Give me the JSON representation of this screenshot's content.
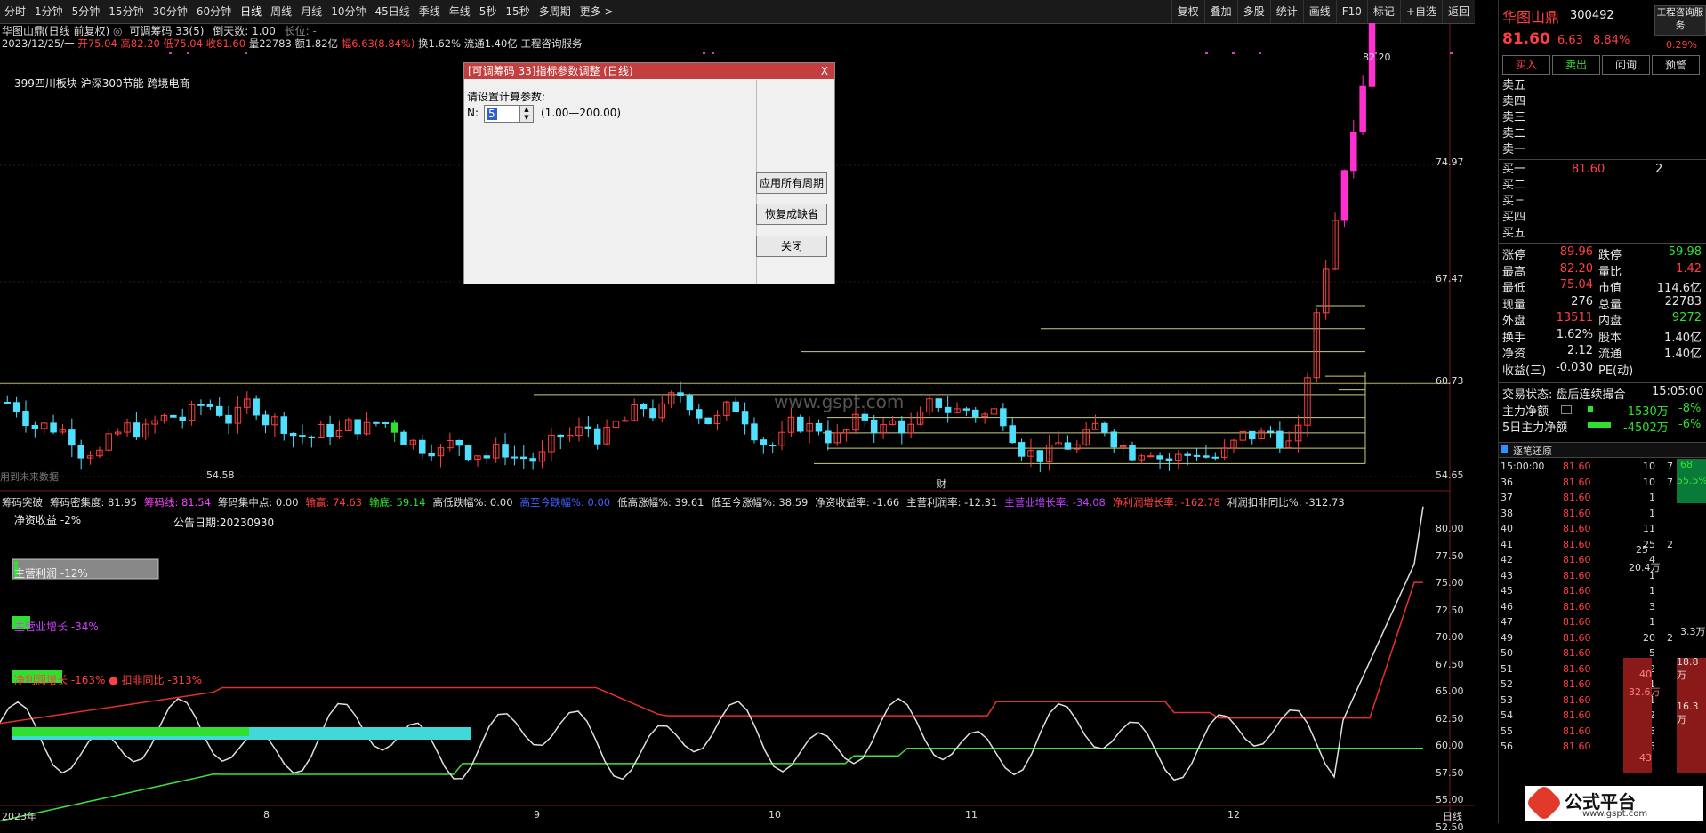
{
  "toolbar": {
    "periods": [
      "分时",
      "1分钟",
      "5分钟",
      "15分钟",
      "30分钟",
      "60分钟",
      "日线",
      "周线",
      "月线",
      "10分钟",
      "45日线",
      "季线",
      "年线",
      "5秒",
      "15秒",
      "多周期",
      "更多 >"
    ],
    "active_period": "日线",
    "tools": [
      "复权",
      "叠加",
      "多股",
      "统计",
      "画线",
      "F10",
      "标记",
      "+自选",
      "返回"
    ]
  },
  "chart_header": {
    "title": "华图山鼎(日线 前复权)",
    "indicator": "可调筹码 33(5)",
    "countdown": "倒天数: 1.00",
    "longpos": "长位: -",
    "quote_line_date": "2023/12/25/一",
    "open": "开75.04",
    "high": "高82.20",
    "low": "低75.04",
    "close": "收81.60",
    "volume": "量22783",
    "amount": "额1.82亿",
    "change_pct": "幅6.63(8.84%)",
    "turnover": "换1.62%",
    "float_cap": "流通1.40亿",
    "industry": "工程咨询服务",
    "blocks": "399四川板块 沪深300节能 跨境电商",
    "watermark": "www.gspt.com",
    "future_data_note": "用到未来数据",
    "peak_label": "82.20",
    "low_label": "54.58",
    "cai_label": "财"
  },
  "main_axis": {
    "ticks": [
      "74.97",
      "67.47",
      "60.73",
      "54.65"
    ]
  },
  "indicator_panel": {
    "header": [
      {
        "text": "筹码突破",
        "color": "#dddddd"
      },
      {
        "text": "筹码密集度: 81.95",
        "color": "#dddddd"
      },
      {
        "text": "筹码线: 81.54",
        "color": "#ff40ff"
      },
      {
        "text": "筹码集中点: 0.00",
        "color": "#dddddd"
      },
      {
        "text": "输赢: 74.63",
        "color": "#ff4040"
      },
      {
        "text": "输底: 59.14",
        "color": "#30e030"
      },
      {
        "text": "高低跌幅%: 0.00",
        "color": "#dddddd"
      },
      {
        "text": "高至今跌幅%: 0.00",
        "color": "#4060ff"
      },
      {
        "text": "低高涨幅%: 39.61",
        "color": "#dddddd"
      },
      {
        "text": "低至今涨幅%: 38.59",
        "color": "#dddddd"
      },
      {
        "text": "净资收益率: -1.66",
        "color": "#dddddd"
      },
      {
        "text": "主营利润率: -12.31",
        "color": "#dddddd"
      },
      {
        "text": "主营业增长率: -34.08",
        "color": "#c040ff"
      },
      {
        "text": "净利润增长率: -162.78",
        "color": "#ff4040"
      },
      {
        "text": "利润扣非同比%: -312.73",
        "color": "#dddddd"
      }
    ],
    "labels": {
      "roe": "净资收益 -2%",
      "announce": "公告日期:20230930",
      "main_profit": "主营利润 -12%",
      "main_growth": "主营业增长 -34%",
      "net_growth": "净利润增长 -163% ● 扣非同比 -313%"
    },
    "axis_ticks": [
      "80.00",
      "77.50",
      "75.00",
      "72.50",
      "70.00",
      "67.50",
      "65.00",
      "62.50",
      "60.00",
      "57.50",
      "55.00",
      "52.50"
    ]
  },
  "date_axis": {
    "labels": [
      "2023年",
      "8",
      "9",
      "10",
      "11",
      "12"
    ],
    "period_label": "日线"
  },
  "dialog": {
    "title": "[可调筹码 33]指标参数调整 (日线)",
    "prompt": "请设置计算参数:",
    "param_label": "N:",
    "param_value": "5",
    "param_range": "(1.00—200.00)",
    "btn_apply_all": "应用所有周期",
    "btn_restore": "恢复成缺省",
    "btn_close": "关闭",
    "close_glyph": "X"
  },
  "quote_panel": {
    "name": "华图山鼎",
    "code": "300492",
    "industry_btn": "工程咨询服务",
    "price": "81.60",
    "change": "6.63",
    "change_pct": "8.84%",
    "small_pct": "0.29%",
    "buttons": [
      "买入",
      "卖出",
      "问询",
      "预警"
    ],
    "asks": [
      "卖五",
      "卖四",
      "卖三",
      "卖二",
      "卖一"
    ],
    "bids": [
      "买一",
      "买二",
      "买三",
      "买四",
      "买五"
    ],
    "bid1_price": "81.60",
    "bid1_vol": "2",
    "stats": [
      {
        "l": "涨停",
        "v": "89.96",
        "vc": "red",
        "l2": "跌停",
        "v2": "59.98",
        "v2c": "grn"
      },
      {
        "l": "最高",
        "v": "82.20",
        "vc": "red",
        "l2": "量比",
        "v2": "1.42",
        "v2c": "red"
      },
      {
        "l": "最低",
        "v": "75.04",
        "vc": "red",
        "l2": "市值",
        "v2": "114.6亿",
        "v2c": "wht"
      },
      {
        "l": "现量",
        "v": "276",
        "vc": "wht",
        "l2": "总量",
        "v2": "22783",
        "v2c": "wht"
      },
      {
        "l": "外盘",
        "v": "13511",
        "vc": "red",
        "l2": "内盘",
        "v2": "9272",
        "v2c": "grn"
      },
      {
        "l": "换手",
        "v": "1.62%",
        "vc": "wht",
        "l2": "股本",
        "v2": "1.40亿",
        "v2c": "wht"
      },
      {
        "l": "净资",
        "v": "2.12",
        "vc": "wht",
        "l2": "流通",
        "v2": "1.40亿",
        "v2c": "wht"
      },
      {
        "l": "收益(三)",
        "v": "-0.030",
        "vc": "wht",
        "l2": "PE(动)",
        "v2": "",
        "v2c": "wht"
      }
    ],
    "trade_status": "交易状态: 盘后连续撮合",
    "trade_time": "15:05:00",
    "main_net": "主力净额",
    "main_net_val": "-1530万",
    "main_net_pct": "-8%",
    "main5_net": "5日主力净额",
    "main5_net_val": "-4502万",
    "main5_net_pct": "-6%",
    "tick_title": "逐笔还原",
    "ticks": [
      {
        "t": "15:00:00",
        "p": "81.60",
        "v": "10",
        "n": "7"
      },
      {
        "t": "36",
        "p": "81.60",
        "v": "10",
        "n": "7"
      },
      {
        "t": "37",
        "p": "81.60",
        "v": "1",
        "n": ""
      },
      {
        "t": "38",
        "p": "81.60",
        "v": "1",
        "n": ""
      },
      {
        "t": "40",
        "p": "81.60",
        "v": "11",
        "n": ""
      },
      {
        "t": "41",
        "p": "81.60",
        "v": "25",
        "n": "2"
      },
      {
        "t": "42",
        "p": "81.60",
        "v": "4",
        "n": ""
      },
      {
        "t": "43",
        "p": "81.60",
        "v": "1",
        "n": ""
      },
      {
        "t": "45",
        "p": "81.60",
        "v": "1",
        "n": ""
      },
      {
        "t": "46",
        "p": "81.60",
        "v": "3",
        "n": ""
      },
      {
        "t": "47",
        "p": "81.60",
        "v": "1",
        "n": ""
      },
      {
        "t": "49",
        "p": "81.60",
        "v": "20",
        "n": "2"
      },
      {
        "t": "50",
        "p": "81.60",
        "v": "5",
        "n": ""
      },
      {
        "t": "51",
        "p": "81.60",
        "v": "12",
        "n": ""
      },
      {
        "t": "52",
        "p": "81.60",
        "v": "1",
        "n": ""
      },
      {
        "t": "53",
        "p": "81.60",
        "v": "1",
        "n": ""
      },
      {
        "t": "54",
        "p": "81.60",
        "v": "2",
        "n": ""
      },
      {
        "t": "55",
        "p": "81.60",
        "v": "5",
        "n": ""
      },
      {
        "t": "56",
        "p": "81.60",
        "v": "5",
        "n": ""
      }
    ],
    "side_values": [
      "68",
      "55.5%",
      "25",
      "20.4万",
      "3.3万",
      "18.8万",
      "40",
      "32.6万",
      "16.3万",
      "43"
    ],
    "logo_text": "公式平台",
    "logo_url": "www.gspt.com"
  }
}
